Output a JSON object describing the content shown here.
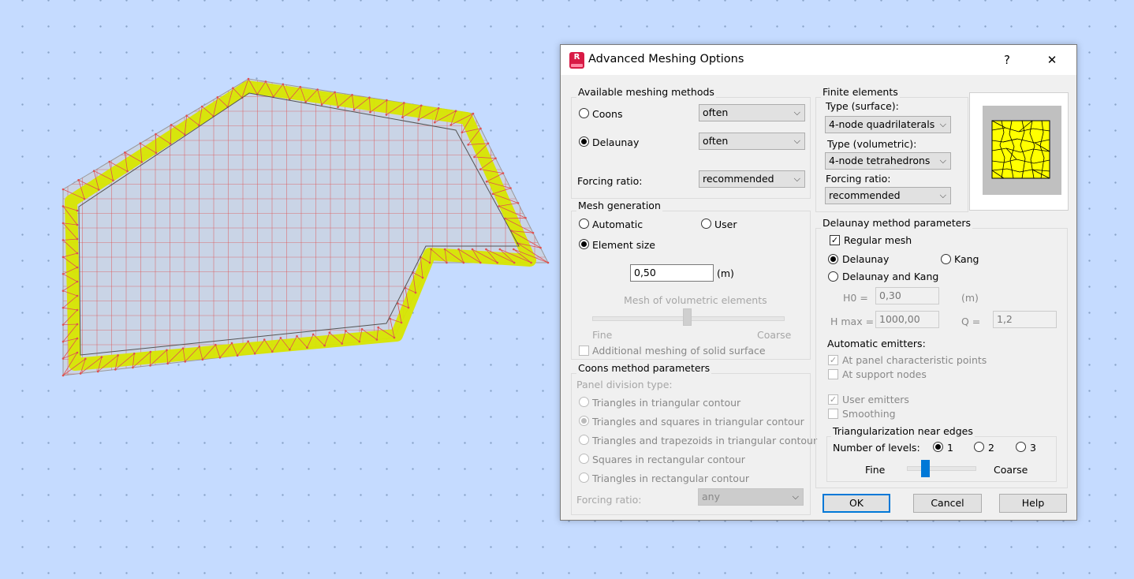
{
  "dialog": {
    "title": "Advanced Meshing Options",
    "app_icon_letter": "R",
    "help_label": "?",
    "close_label": "✕"
  },
  "meshing_methods": {
    "label": "Available meshing methods",
    "coons_label": "Coons",
    "coons_value": "often",
    "delaunay_label": "Delaunay",
    "delaunay_value": "often",
    "forcing_ratio_label": "Forcing ratio:",
    "forcing_ratio_value": "recommended",
    "selected": "Delaunay"
  },
  "mesh_generation": {
    "label": "Mesh generation",
    "automatic_label": "Automatic",
    "user_label": "User",
    "element_size_label": "Element size",
    "element_size_value": "0,50",
    "unit": "(m)",
    "volumetric_label": "Mesh of volumetric elements",
    "fine_label": "Fine",
    "coarse_label": "Coarse",
    "additional_meshing_label": "Additional meshing of solid surface",
    "selected": "Element size"
  },
  "coons_params": {
    "label": "Coons method parameters",
    "panel_division_label": "Panel division type:",
    "options": [
      "Triangles in triangular contour",
      "Triangles and squares in triangular contour",
      "Triangles and trapezoids in triangular contour",
      "Squares in rectangular contour",
      "Triangles in rectangular contour"
    ],
    "forcing_ratio_label": "Forcing ratio:",
    "forcing_ratio_value": "any"
  },
  "finite_elements": {
    "label": "Finite elements",
    "type_surface_label": "Type (surface):",
    "type_surface_value": "4-node quadrilaterals",
    "type_volumetric_label": "Type (volumetric):",
    "type_volumetric_value": "4-node tetrahedrons",
    "forcing_ratio_label": "Forcing ratio:",
    "forcing_ratio_value": "recommended"
  },
  "delaunay_params": {
    "label": "Delaunay method parameters",
    "regular_mesh_label": "Regular mesh",
    "delaunay_label": "Delaunay",
    "kang_label": "Kang",
    "delaunay_kang_label": "Delaunay and Kang",
    "h0_label": "H0 =",
    "h0_value": "0,30",
    "h0_unit": "(m)",
    "hmax_label": "H max =",
    "hmax_value": "1000,00",
    "q_label": "Q =",
    "q_value": "1,2",
    "auto_emitters_label": "Automatic emitters:",
    "at_panel_label": "At panel characteristic points",
    "at_support_label": "At support nodes",
    "user_emitters_label": "User emitters",
    "smoothing_label": "Smoothing"
  },
  "triangularization": {
    "label": "Triangularization near edges",
    "levels_label": "Number of levels:",
    "level_1": "1",
    "level_2": "2",
    "level_3": "3",
    "fine_label": "Fine",
    "coarse_label": "Coarse"
  },
  "buttons": {
    "ok": "OK",
    "cancel": "Cancel",
    "help": "Help"
  },
  "check_mark": "✓",
  "dropdown_arrow": "⌵",
  "colors": {
    "highlight": "#d8e600",
    "mesh_line": "#e05050",
    "background": "#c5dbff",
    "accent": "#0078d7"
  }
}
